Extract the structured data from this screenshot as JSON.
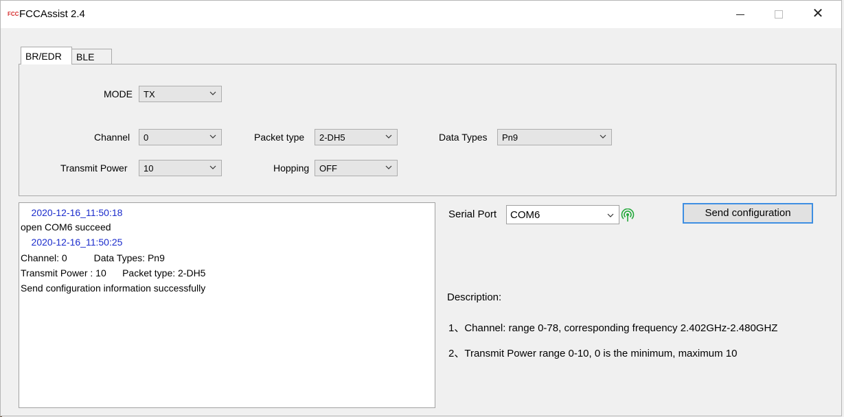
{
  "window": {
    "icon_text": "FCC",
    "title": "FCCAssist 2.4",
    "close_glyph": "✕"
  },
  "tabs": [
    {
      "label": "BR/EDR",
      "active": true
    },
    {
      "label": "BLE",
      "active": false
    }
  ],
  "settings": {
    "mode": {
      "label": "MODE",
      "value": "TX"
    },
    "channel": {
      "label": "Channel",
      "value": "0"
    },
    "packet_type": {
      "label": "Packet type",
      "value": "2-DH5"
    },
    "data_types": {
      "label": "Data Types",
      "value": "Pn9"
    },
    "transmit_power": {
      "label": "Transmit Power",
      "value": "10"
    },
    "hopping": {
      "label": "Hopping",
      "value": "OFF"
    }
  },
  "log": {
    "lines": [
      {
        "text": "    2020-12-16_11:50:18",
        "kind": "timestamp"
      },
      {
        "text": "open COM6 succeed",
        "kind": "message"
      },
      {
        "text": "    2020-12-16_11:50:25",
        "kind": "timestamp"
      },
      {
        "text": "Channel: 0          Data Types: Pn9",
        "kind": "message"
      },
      {
        "text": "Transmit Power : 10      Packet type: 2-DH5",
        "kind": "message"
      },
      {
        "text": "Send configuration information successfully",
        "kind": "message"
      }
    ]
  },
  "serial": {
    "label": "Serial Port",
    "value": "COM6",
    "status_icon": "signal-icon",
    "status_color": "#22a83a"
  },
  "send_button": {
    "label": "Send configuration"
  },
  "description": {
    "title": "Description:",
    "items": [
      "1、Channel: range 0-78, corresponding frequency 2.402GHz-2.480GHZ",
      "2、Transmit Power  range 0-10, 0 is the minimum, maximum 10"
    ]
  }
}
